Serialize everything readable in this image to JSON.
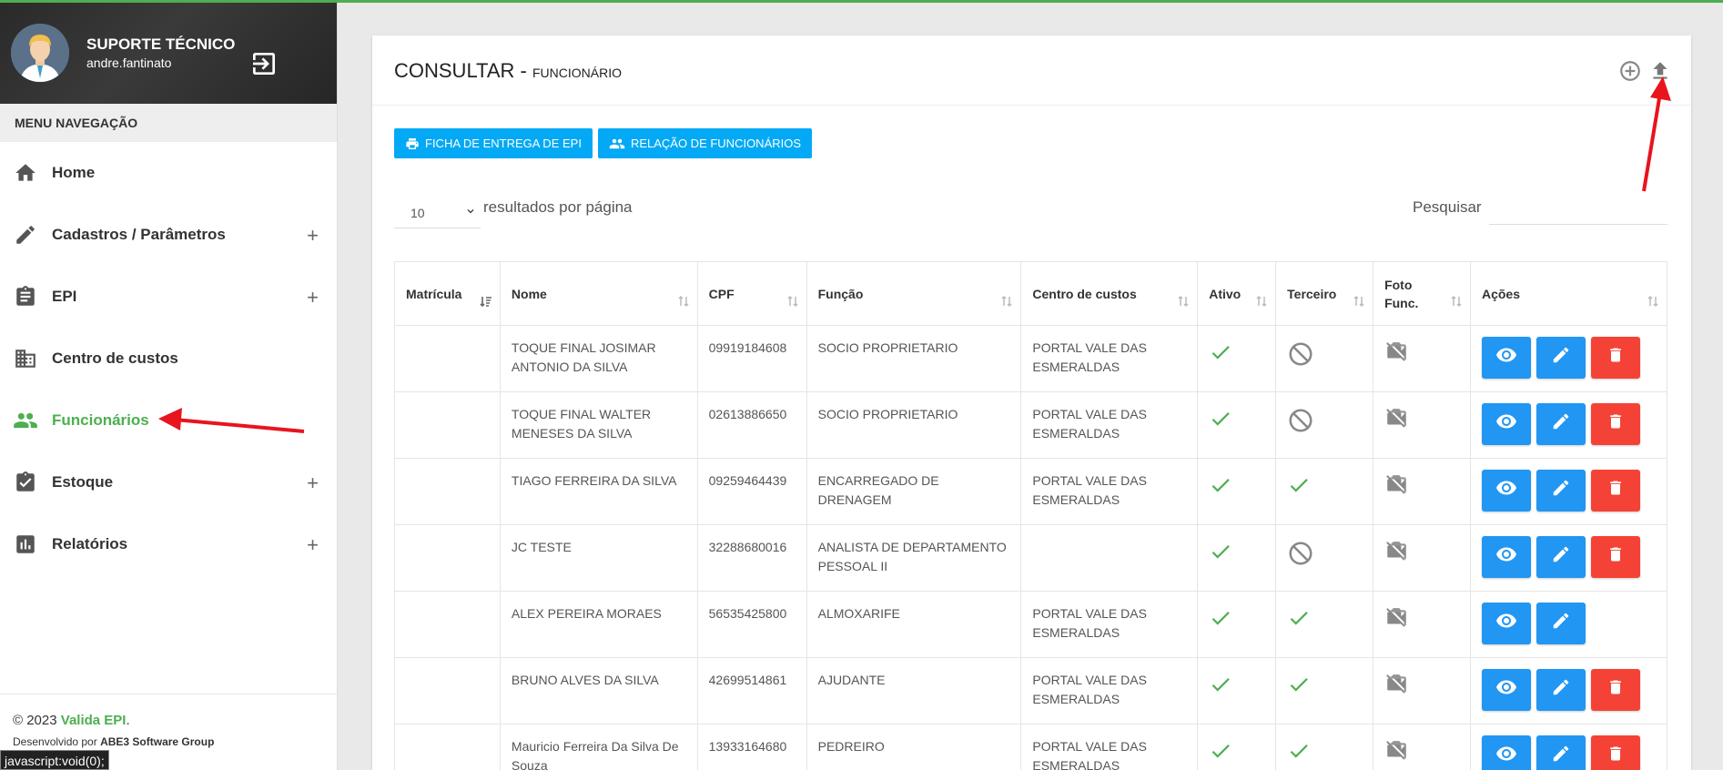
{
  "user": {
    "name": "SUPORTE TÉCNICO",
    "login": "andre.fantinato"
  },
  "menu": {
    "header": "MENU NAVEGAÇÃO",
    "items": [
      {
        "label": "Home",
        "icon": "home-icon",
        "expandable": false,
        "active": false
      },
      {
        "label": "Cadastros / Parâmetros",
        "icon": "pencil-icon",
        "expandable": true,
        "active": false
      },
      {
        "label": "EPI",
        "icon": "clipboard-icon",
        "expandable": true,
        "active": false
      },
      {
        "label": "Centro de custos",
        "icon": "building-icon",
        "expandable": false,
        "active": false
      },
      {
        "label": "Funcionários",
        "icon": "people-icon",
        "expandable": false,
        "active": true
      },
      {
        "label": "Estoque",
        "icon": "clipboard-check-icon",
        "expandable": true,
        "active": false
      },
      {
        "label": "Relatórios",
        "icon": "bar-chart-icon",
        "expandable": true,
        "active": false
      }
    ],
    "expand_symbol": "+"
  },
  "footer": {
    "copyright_prefix": "© 2023 ",
    "brand": "Valida EPI",
    "copyright_suffix": ".",
    "dev_prefix": "Desenvolvido por ",
    "dev_company": "ABE3 Software Group"
  },
  "statusbar": "javascript:void(0);",
  "page": {
    "title": "CONSULTAR - ",
    "subtitle": "FUNCIONÁRIO",
    "btn_ficha": "FICHA DE ENTREGA DE EPI",
    "btn_relacao": "RELAÇÃO DE FUNCIONÁRIOS",
    "perpage_value": "10",
    "perpage_label": "resultados por página",
    "search_label": "Pesquisar",
    "search_value": ""
  },
  "table": {
    "headers": [
      "Matrícula",
      "Nome",
      "CPF",
      "Função",
      "Centro de custos",
      "Ativo",
      "Terceiro",
      "Foto Func.",
      "Ações"
    ],
    "rows": [
      {
        "matricula": "",
        "nome": "TOQUE FINAL JOSIMAR ANTONIO DA SILVA",
        "cpf": "09919184608",
        "funcao": "SOCIO PROPRIETARIO",
        "centro": "PORTAL VALE DAS ESMERALDAS",
        "ativo": true,
        "terceiro": false,
        "delete": true
      },
      {
        "matricula": "",
        "nome": "TOQUE FINAL WALTER MENESES DA SILVA",
        "cpf": "02613886650",
        "funcao": "SOCIO PROPRIETARIO",
        "centro": "PORTAL VALE DAS ESMERALDAS",
        "ativo": true,
        "terceiro": false,
        "delete": true
      },
      {
        "matricula": "",
        "nome": "TIAGO FERREIRA DA SILVA",
        "cpf": "09259464439",
        "funcao": "ENCARREGADO DE DRENAGEM",
        "centro": "PORTAL VALE DAS ESMERALDAS",
        "ativo": true,
        "terceiro": true,
        "delete": true
      },
      {
        "matricula": "",
        "nome": "JC TESTE",
        "cpf": "32288680016",
        "funcao": "ANALISTA DE DEPARTAMENTO PESSOAL II",
        "centro": "",
        "ativo": true,
        "terceiro": false,
        "delete": true
      },
      {
        "matricula": "",
        "nome": "ALEX PEREIRA MORAES",
        "cpf": "56535425800",
        "funcao": "ALMOXARIFE",
        "centro": "PORTAL VALE DAS ESMERALDAS",
        "ativo": true,
        "terceiro": true,
        "delete": false
      },
      {
        "matricula": "",
        "nome": "BRUNO ALVES DA SILVA",
        "cpf": "42699514861",
        "funcao": "AJUDANTE",
        "centro": "PORTAL VALE DAS ESMERALDAS",
        "ativo": true,
        "terceiro": true,
        "delete": true
      },
      {
        "matricula": "",
        "nome": "Mauricio Ferreira Da Silva De Souza",
        "cpf": "13933164680",
        "funcao": "PEDREIRO",
        "centro": "PORTAL VALE DAS ESMERALDAS",
        "ativo": true,
        "terceiro": true,
        "delete": true
      }
    ]
  },
  "colors": {
    "accent": "#4caf50",
    "primary": "#2196f3",
    "danger": "#f44336",
    "info": "#03a9f4",
    "annotation": "#e8141e"
  }
}
